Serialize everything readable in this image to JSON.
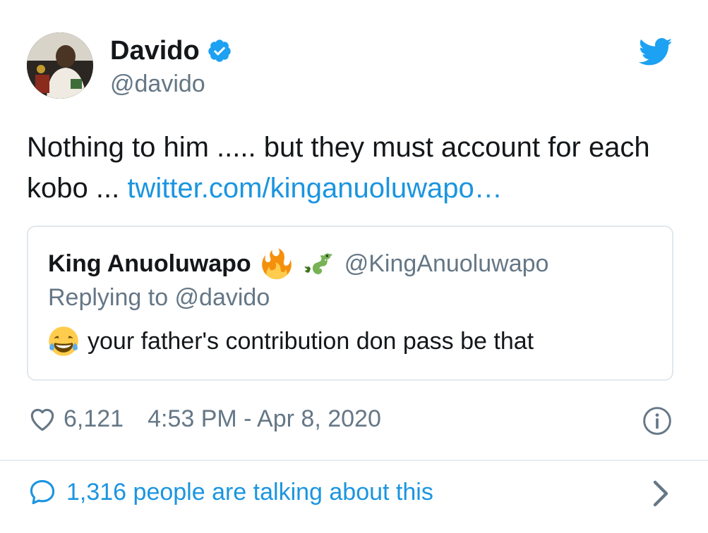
{
  "author": {
    "display_name": "Davido",
    "handle": "@davido",
    "verified": true
  },
  "tweet": {
    "text": "Nothing to him ..... but they must account for each kobo ... ",
    "link": "twitter.com/kinganuoluwapo…"
  },
  "quoted": {
    "display_name": "King Anuoluwapo",
    "name_emojis": [
      "fire-emoji",
      "dragon-emoji"
    ],
    "handle": "@KingAnuoluwapo",
    "reply_context": "Replying to @davido",
    "text_emoji": "tears-of-joy-emoji",
    "text": "your father's contribution don pass be that"
  },
  "meta": {
    "like_count": "6,121",
    "timestamp": "4:53 PM - Apr 8, 2020"
  },
  "footer": {
    "talking_text": "1,316 people are talking about this"
  },
  "colors": {
    "link_blue": "#1b95e0",
    "verified_blue": "#1da1f2",
    "muted_gray": "#657786",
    "border": "#e1e8ed"
  }
}
